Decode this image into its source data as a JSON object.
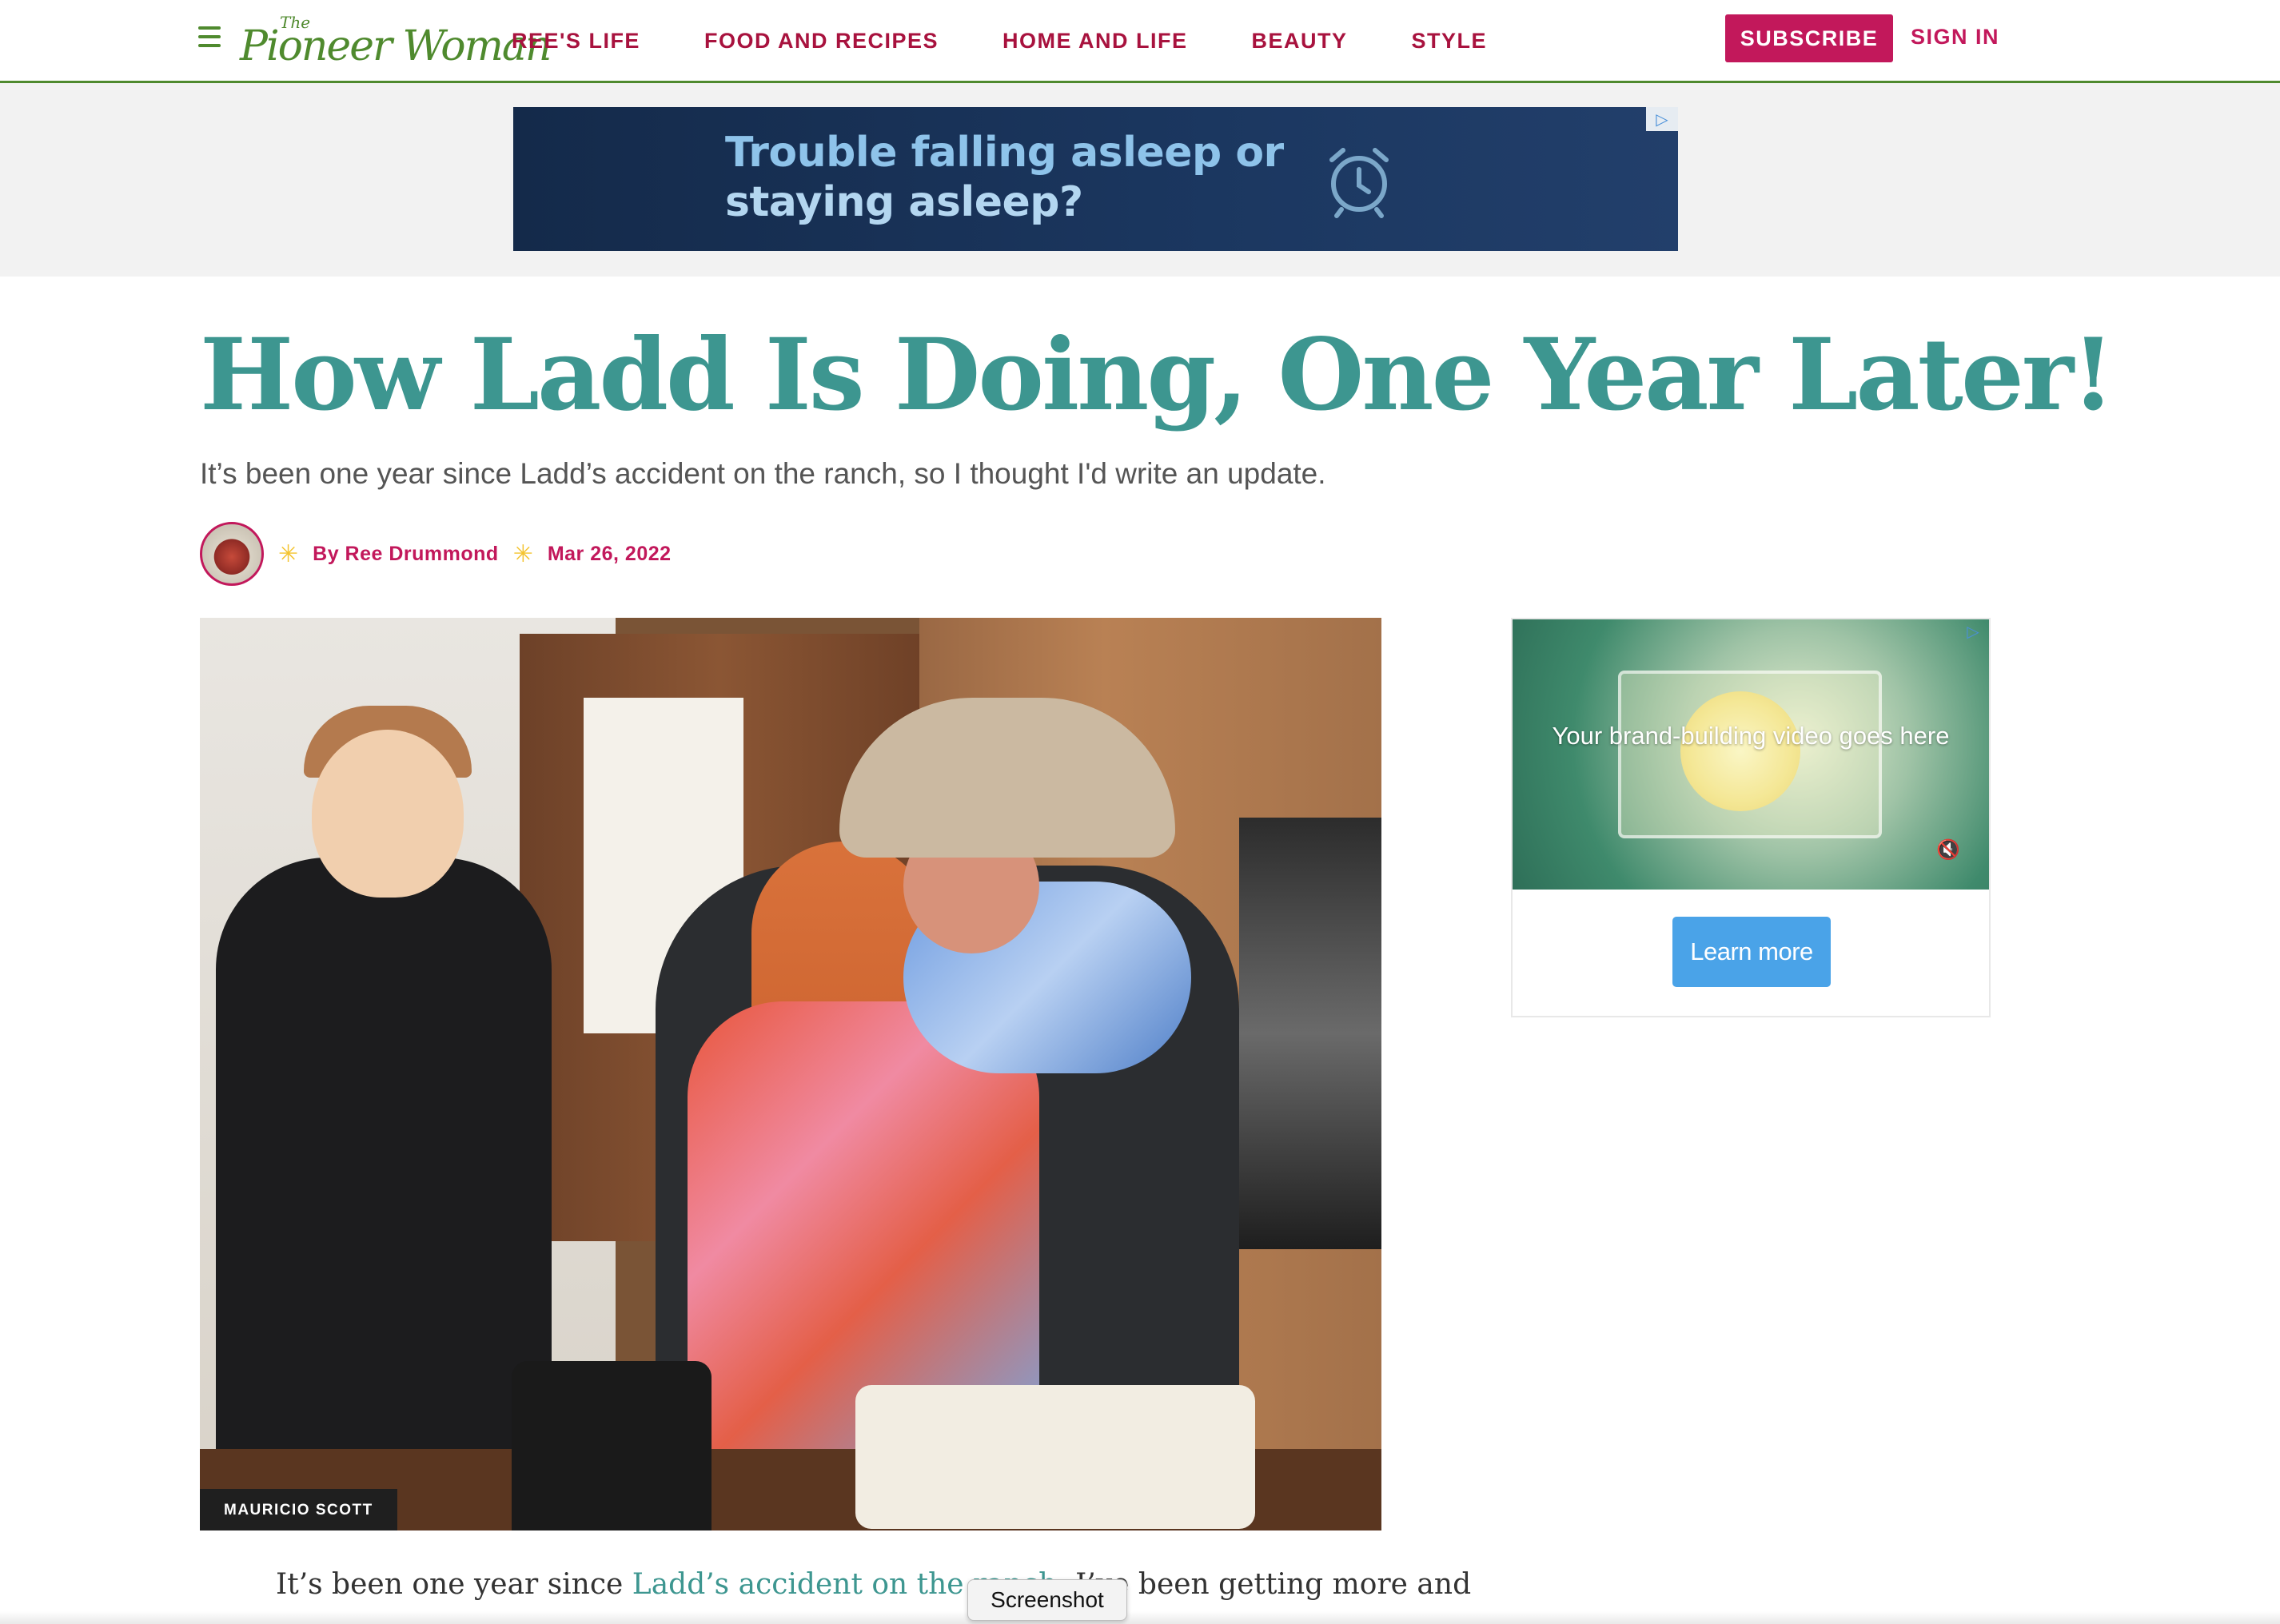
{
  "header": {
    "logo_the": "The",
    "logo_name": "Pioneer Woman",
    "nav": [
      "REE'S LIFE",
      "FOOD AND RECIPES",
      "HOME AND LIFE",
      "BEAUTY",
      "STYLE"
    ],
    "subscribe_label": "SUBSCRIBE",
    "signin_label": "SIGN IN",
    "brand_color": "#4f8a2e",
    "accent_color": "#c2185b"
  },
  "top_ad": {
    "line1": "Trouble falling asleep or",
    "line2": "staying asleep?",
    "icon": "alarm-clock-icon"
  },
  "article": {
    "title": "How Ladd Is Doing, One Year Later!",
    "dek": "It’s been one year since Ladd’s accident on the ranch, so I thought I'd write an update.",
    "author": "By Ree Drummond",
    "date": "Mar 26, 2022",
    "photo_credit": "MAURICIO SCOTT",
    "title_color": "#3d9690",
    "body_start": "It’s been one year since ",
    "body_link": "Ladd’s accident on the ranch",
    "body_rest": ". I’ve been getting more and"
  },
  "side_ad": {
    "video_text": "Your brand-building video goes here",
    "cta_label": "Learn more"
  },
  "overlay": {
    "tooltip": "Screenshot"
  }
}
